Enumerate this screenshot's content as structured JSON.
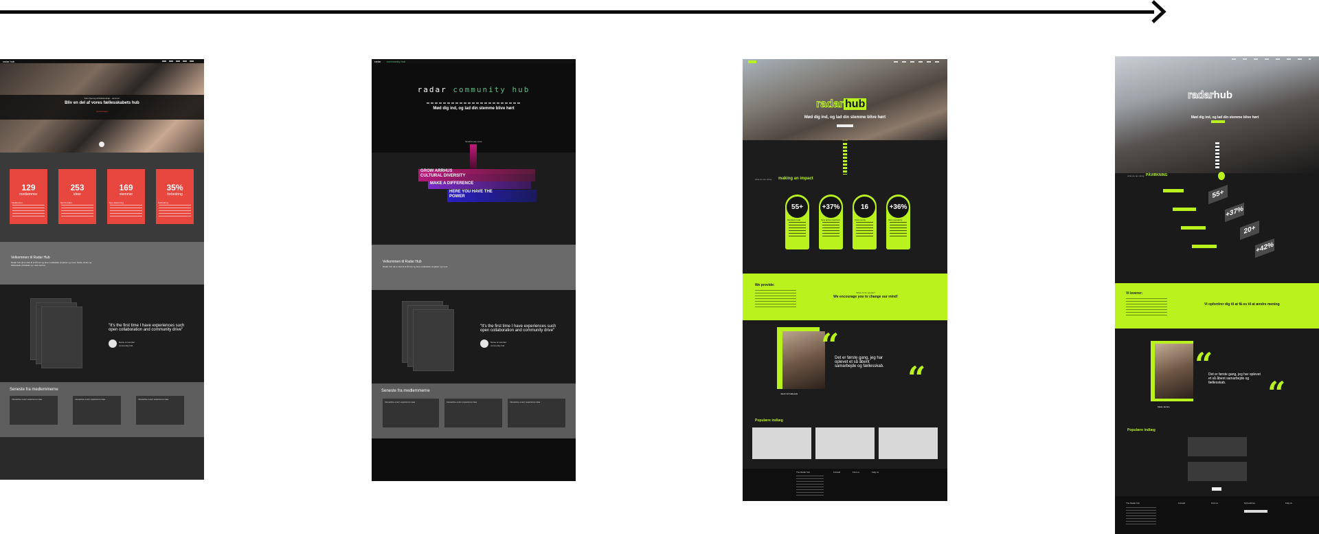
{
  "board1": {
    "nav_logo": "radar hub",
    "hero_kicker": "Dein hjemag artistfellesskap - sammen",
    "hero_title": "Bliv en del af vores fællesskabets hub",
    "hero_cta": "Opret bruger",
    "stats": [
      {
        "num": "129",
        "label": "medlemmer",
        "title": "Medlemmer"
      },
      {
        "num": "253",
        "label": "ideer",
        "title": "Nyt fra siden"
      },
      {
        "num": "169",
        "label": "stemmer",
        "title": "Nye afstemning"
      },
      {
        "num": "35%",
        "label": "forbedring",
        "title": "Forbedring"
      }
    ],
    "welcome_title": "Velkommen til Radar Hub",
    "welcome_text": "Radar hub på et sted til at få hørt og lave musikalske projekter og mere. Sætte skræv og fællesskab på Radar og i hele Aarhus",
    "quote": "\"It's the first time I have experiences such open collaboration and community drive\"",
    "quote_author": "Name of member",
    "quote_role": "community hub",
    "reviews_title": "Seneste fra medlemmerne",
    "reviews": [
      "Interactive event experience idea",
      "Interactive event experience idea",
      "Interactive event experience idea"
    ]
  },
  "board2": {
    "nav_logo": "radar",
    "nav_sub": "community hub",
    "title_a": "radar",
    "title_b": "community hub",
    "subtitle": "Mød dig ind, og lad din stemme blive hørt",
    "scroll_label": "Scroll to see more",
    "bars": [
      "GROW ARRHUS",
      "CULTURAL DIVERSITY",
      "MAKE A DIFFERENCE",
      "HERE YOU HAVE THE",
      "POWER"
    ],
    "welcome_title": "Velkommen til Radar Hub",
    "welcome_text": "Radar hub på et sted til at få hørt og lave musikalske projekter og mere",
    "quote": "\"It's the first time I have experiences such open collaboration and community drive\"",
    "quote_author": "Name of member",
    "quote_role": "community hub",
    "reviews_title": "Seneste fra medlemmerne",
    "reviews": [
      "Interactive event experience idea",
      "Interactive event experience idea",
      "Interactive event experience idea"
    ]
  },
  "board3": {
    "logo_a": "radar",
    "logo_b": "hub",
    "subtitle": "Mød dig ind, og lad din stemme blive hørt",
    "scroll_label": "Scroll",
    "impact_small": "what we are doing",
    "impact_title": "making an impact",
    "pills": [
      {
        "num": "55+",
        "title": "Members total"
      },
      {
        "num": "+37%",
        "title": "New active members"
      },
      {
        "num": "16",
        "title": "Total events"
      },
      {
        "num": "+36%",
        "title": "Most popularity"
      }
    ],
    "provide_title": "We provide:",
    "provide_small": "What it's for people?",
    "provide_tagline": "We encourage you to change our mind!",
    "quote": "Det er første gang, jeg har oplevet et så åbent samarbejde og fællesskab.",
    "quote_author": "Jacob Et Falkeside",
    "popular_title": "Populære indlæg",
    "footer_cols": [
      "The Radar hub",
      "Kontakt",
      "Find os",
      "Følg os"
    ]
  },
  "board4": {
    "logo_a": "radar",
    "logo_b": "hub",
    "subtitle": "Mød dig ind, og lad din stemme blive hørt",
    "impact_title": "PÅVIRKNING",
    "steps": [
      "55+",
      "+37%",
      "20+",
      "+42%"
    ],
    "lime_title": "Vi leverer:",
    "lime_tagline": "Vi opfordrer dig til at få os til at ændre mening",
    "quote": "Det er første gang, jeg har oplevet et så åbent samarbejde og fællesskab.",
    "quote_author": "Mads Jacobs",
    "popular_title": "Populære indlæg",
    "footer_cols": [
      "The Radar hub",
      "Kontakt",
      "Find os",
      "Nyhedsbrev",
      "Følg os"
    ]
  },
  "colors": {
    "lime": "#b9f21d",
    "coral": "#e8473f",
    "pink": "#c21a7a",
    "indigo": "#2b1fc6"
  }
}
